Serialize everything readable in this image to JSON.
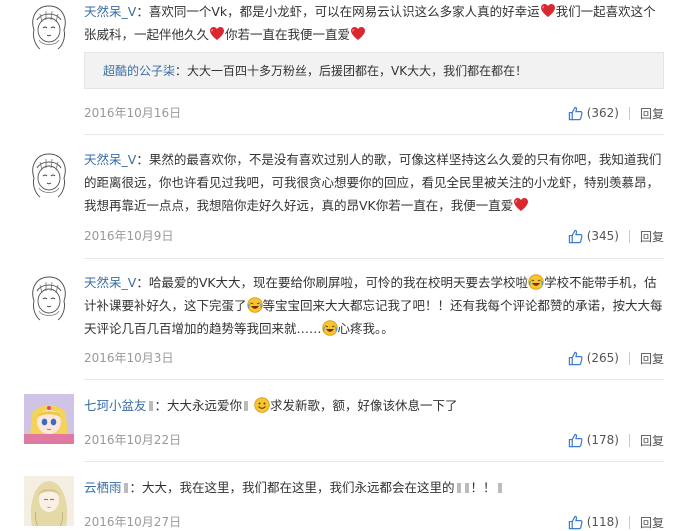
{
  "comments": [
    {
      "username": "天然呆_V",
      "text_parts": [
        "：喜欢同一个Vk，都是小龙虾，可以在网易云认识这么多家人真的好幸运",
        "我们一起喜欢这个张威科，一起伴他久久",
        "你若一直在我便一直爱"
      ],
      "reply": {
        "username": "超酷的公子柒",
        "text": "：大大一百四十多万粉丝，后援团都在，VK大大，我们都在都在！"
      },
      "date": "2016年10月16日",
      "likes": "(362)",
      "reply_label": "回复"
    },
    {
      "username": "天然呆_V",
      "text_parts": [
        "：果然的最喜欢你，不是没有喜欢过别人的歌，可像这样坚持这么久爱的只有你吧，我知道我们的距离很远，你也许看见过我吧，可我很贪心想要你的回应，看见全民里被关注的小龙虾，特别羡慕昂，我想再靠近一点点，我想陪你走好久好远，真的昂VK你若一直在，我便一直爱"
      ],
      "date": "2016年10月9日",
      "likes": "(345)",
      "reply_label": "回复"
    },
    {
      "username": "天然呆_V",
      "text_parts": [
        "：哈最爱的VK大大，现在要给你刷屏啦，可怜的我在校明天要去学校啦",
        "学校不能带手机，估计补课要补好久，这下完蛋了",
        "等宝宝回来大大都忘记我了吧！！还有我每个评论都赞的承诺，按大大每天评论几百几百增加的趋势等我回来就……",
        "心疼我。。"
      ],
      "date": "2016年10月3日",
      "likes": "(265)",
      "reply_label": "回复"
    },
    {
      "username": "七珂小盆友",
      "text_parts": [
        "：大大永远爱你",
        "求发新歌，额，好像该休息一下了"
      ],
      "date": "2016年10月22日",
      "likes": "(178)",
      "reply_label": "回复"
    },
    {
      "username": "云栖雨",
      "text_parts": [
        "：大大，我在这里，我们都在这里，我们永远都会在这里的",
        "！！"
      ],
      "date": "2016年10月27日",
      "likes": "(118)",
      "reply_label": "回复"
    }
  ],
  "icons": {
    "like": "thumbs-up-icon",
    "heart": "heart-emoji-icon",
    "laugh_cry": "laugh-cry-emoji-icon",
    "smile": "smile-emoji-icon"
  },
  "colors": {
    "username": "#3a6ea5",
    "date": "#999999",
    "heart": "#d9282f"
  }
}
